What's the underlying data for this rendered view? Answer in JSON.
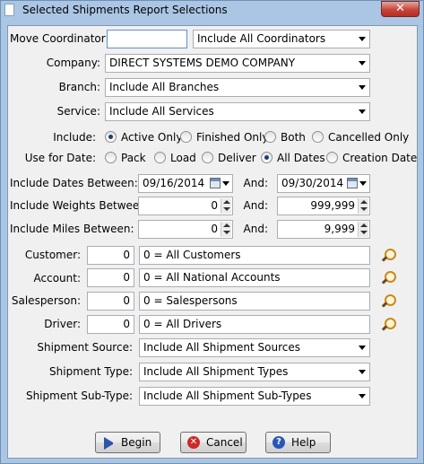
{
  "window": {
    "title": "Selected Shipments Report Selections",
    "close_glyph": "✕"
  },
  "labels": {
    "move_coordinator": "Move Coordinator:",
    "company": "Company:",
    "branch": "Branch:",
    "service": "Service:",
    "include": "Include:",
    "use_for_date": "Use for Date:",
    "include_dates_between": "Include Dates Between:",
    "include_weights_between": "Include Weights Between:",
    "include_miles_between": "Include Miles Between:",
    "and": "And:",
    "customer": "Customer:",
    "account": "Account:",
    "salesperson": "Salesperson:",
    "driver": "Driver:",
    "shipment_source": "Shipment Source:",
    "shipment_type": "Shipment Type:",
    "shipment_sub_type": "Shipment Sub-Type:"
  },
  "fields": {
    "move_coordinator_value": "",
    "coordinator_select": "Include All Coordinators",
    "company_select": "DIRECT SYSTEMS DEMO COMPANY",
    "branch_select": "Include All Branches",
    "service_select": "Include All Services",
    "date_from": "09/16/2014",
    "date_to": "09/30/2014",
    "weight_from": "0",
    "weight_to": "999,999",
    "miles_from": "0",
    "miles_to": "9,999",
    "customer_code": "0",
    "customer_desc": "0 = All Customers",
    "account_code": "0",
    "account_desc": "0 = All National Accounts",
    "salesperson_code": "0",
    "salesperson_desc": "0 = Salespersons",
    "driver_code": "0",
    "driver_desc": "0 = All Drivers",
    "shipment_source_select": "Include All Shipment Sources",
    "shipment_type_select": "Include All Shipment Types",
    "shipment_sub_type_select": "Include All Shipment Sub-Types"
  },
  "include_options": {
    "active_only": "Active Only",
    "finished_only": "Finished Only",
    "both": "Both",
    "cancelled_only": "Cancelled Only",
    "selected": "Active Only"
  },
  "date_options": {
    "pack": "Pack",
    "load": "Load",
    "deliver": "Deliver",
    "all_dates": "All Dates",
    "creation_date": "Creation Date",
    "selected": "All Dates"
  },
  "buttons": {
    "begin": "Begin",
    "cancel": "Cancel",
    "help": "Help",
    "cancel_glyph": "✕",
    "help_glyph": "?"
  },
  "icons": {
    "search": "magnifier-icon",
    "calendar": "calendar-icon",
    "begin": "play-arrow-icon",
    "cancel": "cancel-icon",
    "help": "help-icon"
  }
}
